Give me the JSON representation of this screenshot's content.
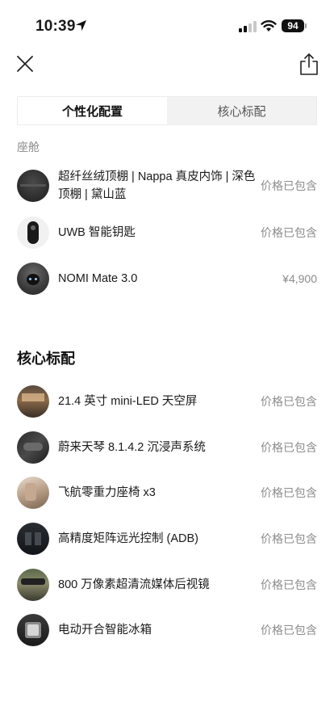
{
  "status": {
    "time": "10:39",
    "battery": "94"
  },
  "tabs": [
    {
      "label": "个性化配置",
      "active": true
    },
    {
      "label": "核心标配",
      "active": false
    }
  ],
  "cabin": {
    "label": "座舱",
    "items": [
      {
        "name": "超纤丝绒顶棚 | Nappa 真皮内饰 | 深色顶棚 | 黛山蓝",
        "price": "价格已包含"
      },
      {
        "name": "UWB 智能钥匙",
        "price": "价格已包含"
      },
      {
        "name": "NOMI Mate 3.0",
        "price": "¥4,900"
      }
    ]
  },
  "core": {
    "title": "核心标配",
    "items": [
      {
        "name": "21.4 英寸 mini-LED 天空屏",
        "price": "价格已包含"
      },
      {
        "name": "蔚来天琴 8.1.4.2 沉浸声系统",
        "price": "价格已包含"
      },
      {
        "name": "飞航零重力座椅 x3",
        "price": "价格已包含"
      },
      {
        "name": "高精度矩阵远光控制 (ADB)",
        "price": "价格已包含"
      },
      {
        "name": "800 万像素超清流媒体后视镜",
        "price": "价格已包含"
      },
      {
        "name": "电动开合智能冰箱",
        "price": "价格已包含"
      }
    ]
  },
  "icons": {
    "close": "close-icon",
    "share": "share-icon",
    "location": "location-arrow-icon",
    "signal": "cellular-signal-icon",
    "wifi": "wifi-icon"
  }
}
